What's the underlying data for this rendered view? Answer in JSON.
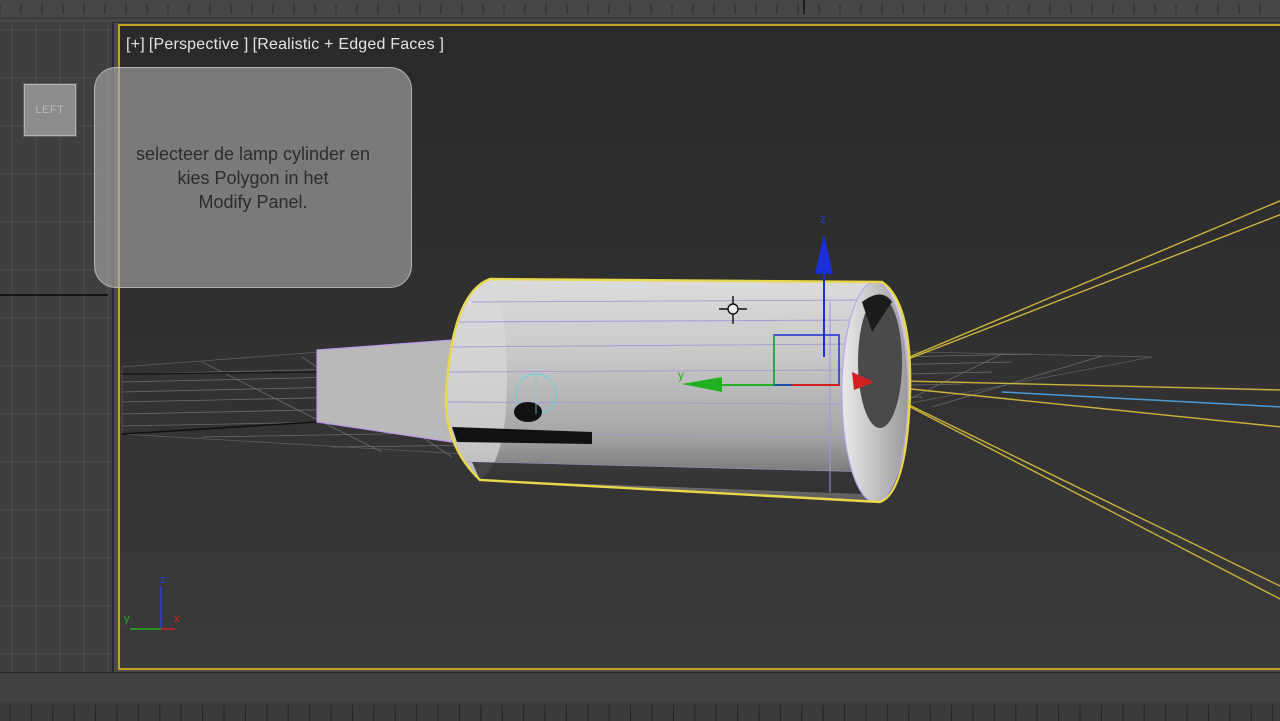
{
  "viewport": {
    "plus": "[+]",
    "view": "[Perspective ]",
    "shading": "[Realistic + Edged Faces ]"
  },
  "left_viewport": {
    "viewcube_label": "LEFT"
  },
  "tooltip": {
    "line1": "selecteer de lamp cylinder en",
    "line2": "kies Polygon in het",
    "line3": "Modify Panel."
  },
  "gizmo": {
    "z": "z",
    "y": "y"
  },
  "corner_axes": {
    "z": "z",
    "y": "y",
    "x": "x"
  },
  "colors": {
    "selection": "#e8d84a",
    "x_axis": "#d22020",
    "y_axis": "#20b020",
    "z_axis": "#1a2fd8",
    "viewport_border": "#c4a31e"
  }
}
